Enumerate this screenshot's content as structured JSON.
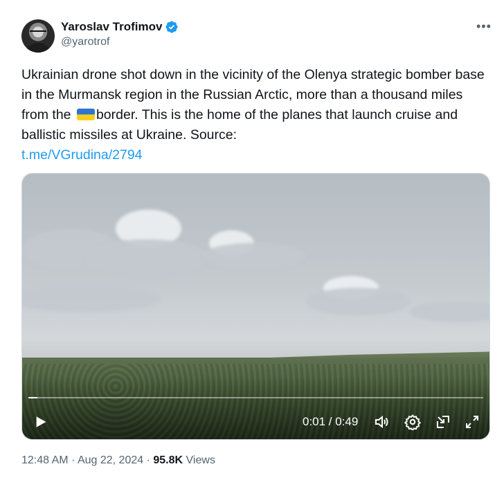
{
  "author": {
    "name": "Yaroslav Trofimov",
    "handle": "@yarotrof"
  },
  "tweet": {
    "text_part1": "Ukrainian drone shot down in the vicinity of the Olenya strategic bomber base in the Murmansk region in the Russian Arctic, more than a thousand miles from the",
    "text_part2": "border. This is the home of the planes that launch cruise and ballistic missiles at Ukraine. Source:",
    "link": "t.me/VGrudina/2794"
  },
  "video": {
    "time_display": "0:01 / 0:49",
    "progress": 0.02
  },
  "meta": {
    "time": "12:48 AM",
    "separator": "·",
    "date": "Aug 22, 2024",
    "views_count": "95.8K",
    "views_label": "Views"
  },
  "colors": {
    "link": "#1d9bf0",
    "verified": "#1d9bf0",
    "secondary_text": "#536471"
  },
  "icons": {
    "more": "more-icon",
    "verified": "verified-badge-icon",
    "flag": "ukraine-flag-emoji"
  }
}
